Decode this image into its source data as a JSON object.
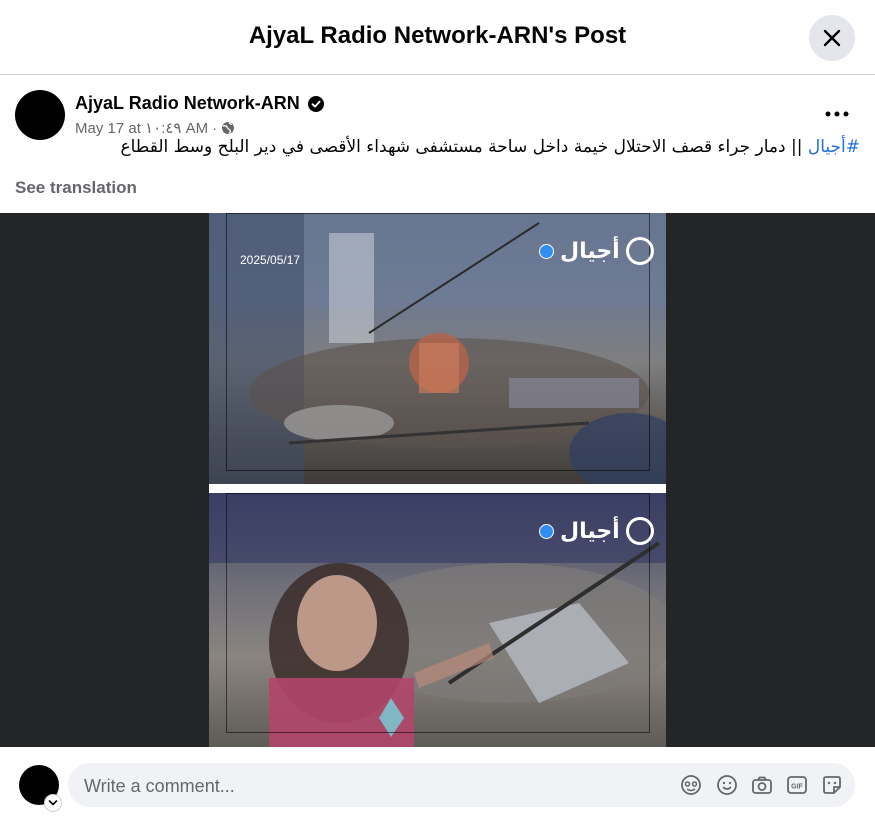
{
  "header": {
    "title": "AjyaL Radio Network-ARN's Post",
    "close_icon": "close-icon"
  },
  "post": {
    "author": "AjyaL Radio Network-ARN",
    "verified_icon": "verified-badge-icon",
    "time": "May 17 at ١٠:٤٩ AM",
    "separator": "·",
    "audience_icon": "globe-icon",
    "hashtag": "#أجيال",
    "text": " || دمار جراء قصف الاحتلال خيمة داخل ساحة مستشفى شهداء الأقصى في دير البلح وسط القطاع",
    "see_translation": "See translation",
    "more_icon": "more-options-icon"
  },
  "media": {
    "photo1": {
      "logo_text": "أجيال",
      "date": "2025/05/17"
    },
    "photo2": {
      "logo_text": "أجيال"
    }
  },
  "comment": {
    "placeholder": "Write a comment...",
    "icons": [
      "avatar-sticker-icon",
      "emoji-icon",
      "camera-icon",
      "gif-icon",
      "sticker-icon"
    ]
  },
  "colors": {
    "link": "#216fdb",
    "secondary_text": "#65676b",
    "input_bg": "#f0f2f5",
    "verified": "#2f8ef0"
  }
}
